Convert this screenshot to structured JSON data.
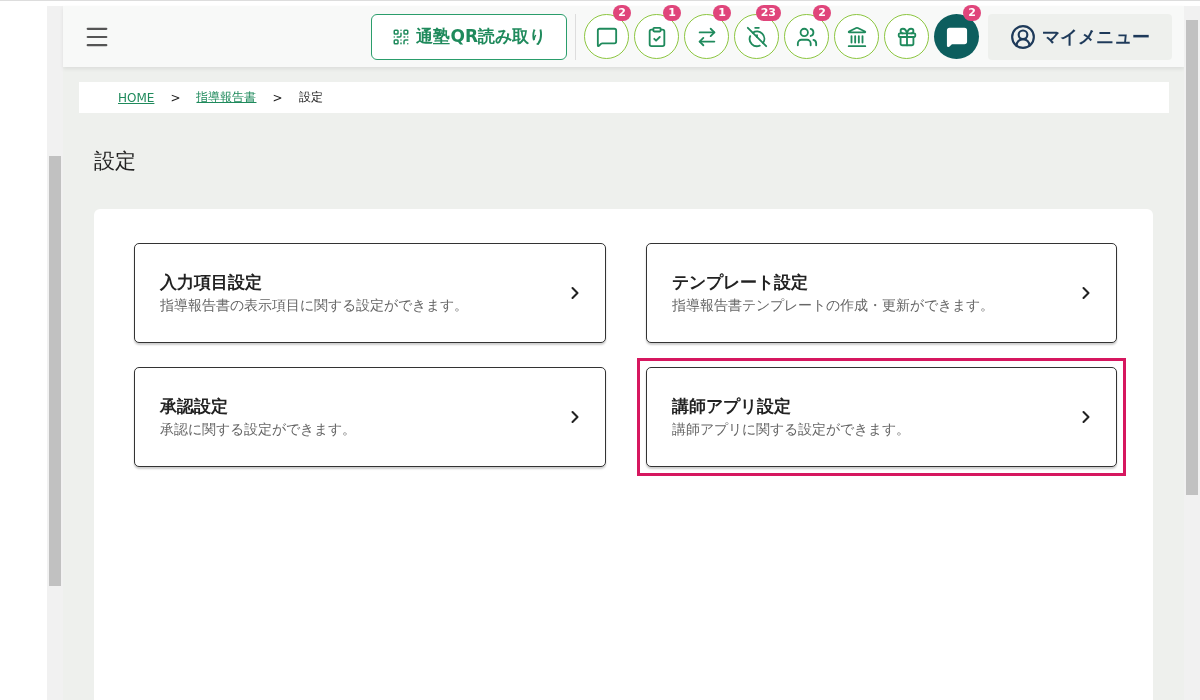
{
  "header": {
    "qr_button": "通塾QR読み取り",
    "icon_buttons": [
      {
        "badge": "2",
        "filled": false
      },
      {
        "badge": "1",
        "filled": false
      },
      {
        "badge": "1",
        "filled": false
      },
      {
        "badge": "23",
        "filled": false
      },
      {
        "badge": "2",
        "filled": false
      },
      {
        "filled": false
      },
      {
        "filled": false
      },
      {
        "badge": "2",
        "filled": true
      }
    ],
    "my_menu": "マイメニュー"
  },
  "breadcrumb": [
    {
      "label": "HOME",
      "link": true
    },
    {
      "label": ">",
      "link": false
    },
    {
      "label": "指導報告書",
      "link": true
    },
    {
      "label": ">",
      "link": false
    },
    {
      "label": "設定",
      "link": false
    }
  ],
  "page_title": "設定",
  "cards": [
    {
      "title": "入力項目設定",
      "description": "指導報告書の表示項目に関する設定ができます。",
      "highlighted": false
    },
    {
      "title": "テンプレート設定",
      "description": "指導報告書テンプレートの作成・更新ができます。",
      "highlighted": false
    },
    {
      "title": "承認設定",
      "description": "承認に関する設定ができます。",
      "highlighted": false
    },
    {
      "title": "講師アプリ設定",
      "description": "講師アプリに関する設定ができます。",
      "highlighted": true
    }
  ]
}
